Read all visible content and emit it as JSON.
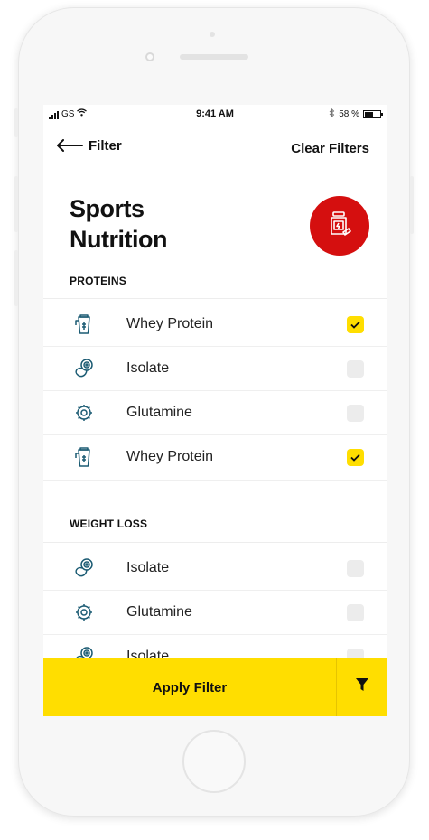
{
  "status_bar": {
    "carrier": "GS",
    "time": "9:41 AM",
    "battery": "58 %",
    "battery_level": 0.58
  },
  "nav": {
    "back_label": "Filter",
    "clear_label": "Clear Filters"
  },
  "page": {
    "title_line1": "Sports",
    "title_line2": "Nutrition",
    "category_icon": "supplement-jar-icon",
    "accent": "#d50f0f"
  },
  "sections": [
    {
      "heading": "PROTEINS",
      "items": [
        {
          "label": "Whey Protein",
          "icon": "shaker-icon",
          "checked": true
        },
        {
          "label": "Isolate",
          "icon": "measuring-tape-icon",
          "checked": false
        },
        {
          "label": "Glutamine",
          "icon": "gear-icon",
          "checked": false
        },
        {
          "label": "Whey Protein",
          "icon": "shaker-icon",
          "checked": true
        }
      ]
    },
    {
      "heading": "WEIGHT LOSS",
      "items": [
        {
          "label": "Isolate",
          "icon": "measuring-tape-icon",
          "checked": false
        },
        {
          "label": "Glutamine",
          "icon": "gear-icon",
          "checked": false
        },
        {
          "label": "Isolate",
          "icon": "measuring-tape-icon",
          "checked": false
        }
      ]
    }
  ],
  "footer": {
    "apply_label": "Apply Filter",
    "filter_icon": "funnel-icon",
    "color": "#ffde00"
  }
}
